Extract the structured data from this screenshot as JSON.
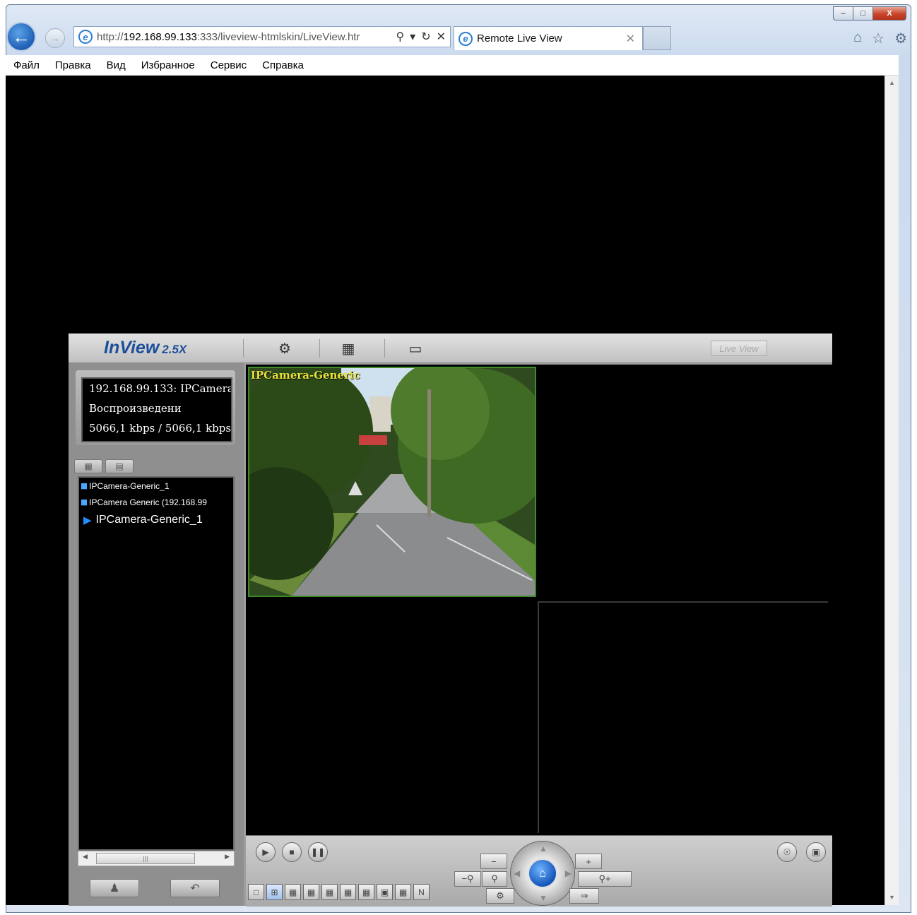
{
  "browser": {
    "url_prefix": "http://",
    "url_host": "192.168.99.133",
    "url_rest": ":333/liveview-htmlskin/LiveView.htr",
    "tab_title": "Remote Live View",
    "caption_buttons": {
      "minimize": "–",
      "maximize": "□",
      "close": "X"
    },
    "menu": [
      "Файл",
      "Правка",
      "Вид",
      "Избранное",
      "Сервис",
      "Справка"
    ]
  },
  "app": {
    "logo": "InView",
    "version": "2.5X",
    "live_view_label": "Live View",
    "info": {
      "line1": "192.168.99.133: IPCamera",
      "line2": "Воспроизведени",
      "line3": "5066,1 kbps / 5066,1 kbps"
    },
    "tree": [
      "IPCamera-Generic_1",
      "IPCamera Generic (192.168.99",
      "IPCamera-Generic_1"
    ],
    "camera_label": "IPCamera-Generic",
    "accent_green": "#3c8a28",
    "icons": {
      "toolbar": [
        "film-reel-icon",
        "camera-folder-icon",
        "monitor-icon"
      ],
      "playback": [
        "play-icon",
        "stop-icon",
        "pause-icon"
      ],
      "ptz": [
        "home-icon",
        "zoom-out-icon",
        "zoom-in-icon",
        "focus-icon",
        "settings-icon"
      ]
    }
  }
}
